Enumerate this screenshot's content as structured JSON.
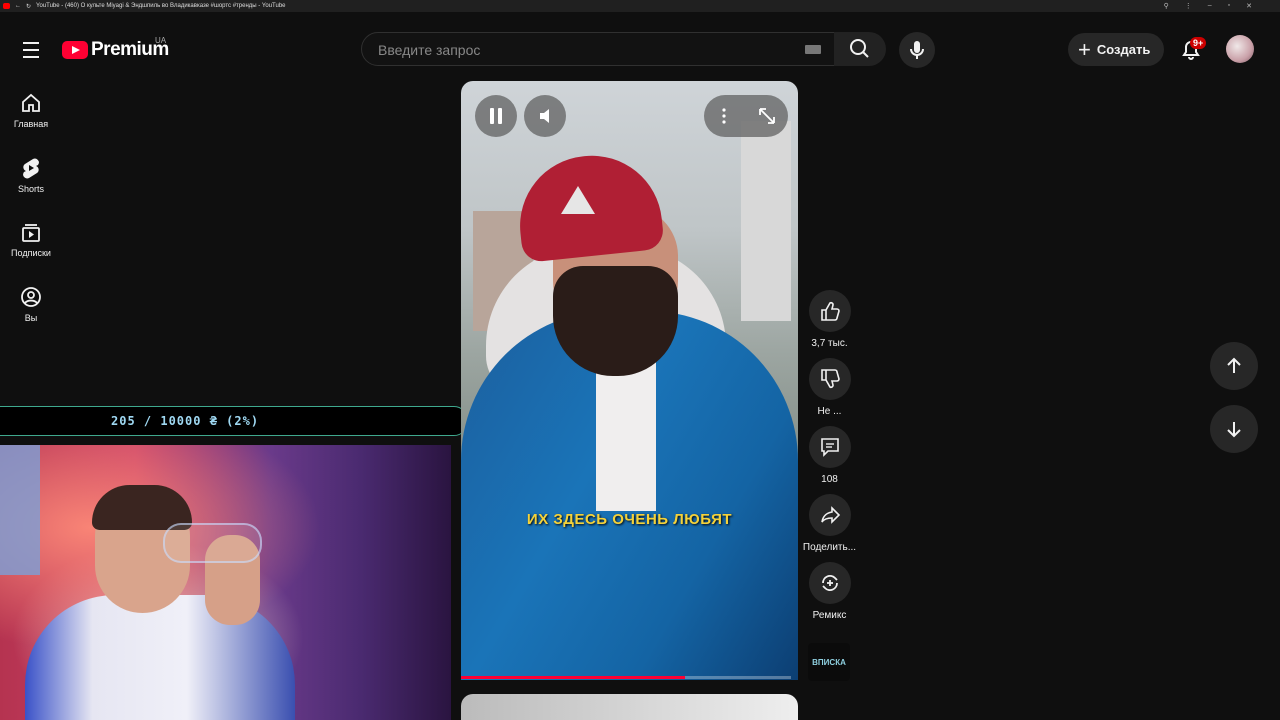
{
  "browser": {
    "tab_title": "YouTube - (460) О культе Miyagi & Эндшпиль во Владикавказе #шортс #тренды - YouTube"
  },
  "header": {
    "brand": "Premium",
    "region": "UA",
    "search_placeholder": "Введите запрос",
    "create_label": "Создать",
    "notifications_badge": "9+"
  },
  "sidebar": {
    "items": [
      {
        "label": "Главная",
        "icon": "home-icon"
      },
      {
        "label": "Shorts",
        "icon": "shorts-icon"
      },
      {
        "label": "Подписки",
        "icon": "subscriptions-icon"
      },
      {
        "label": "Вы",
        "icon": "account-icon"
      }
    ]
  },
  "donation": {
    "text": "205 / 10000 ₴ (2%)",
    "progress": 0.0205
  },
  "video": {
    "caption": "ИХ ЗДЕСЬ ОЧЕНЬ ЛЮБЯТ",
    "progress": 0.68
  },
  "actions": {
    "like_count": "3,7 тыс.",
    "dislike_label": "Не ...",
    "comments_count": "108",
    "share_label": "Поделить...",
    "remix_label": "Ремикс",
    "channel_thumb_text": "ВПИСКА"
  },
  "colors": {
    "accent": "#ff0033",
    "caption": "#f4d23a",
    "background": "#0f0f0f"
  }
}
